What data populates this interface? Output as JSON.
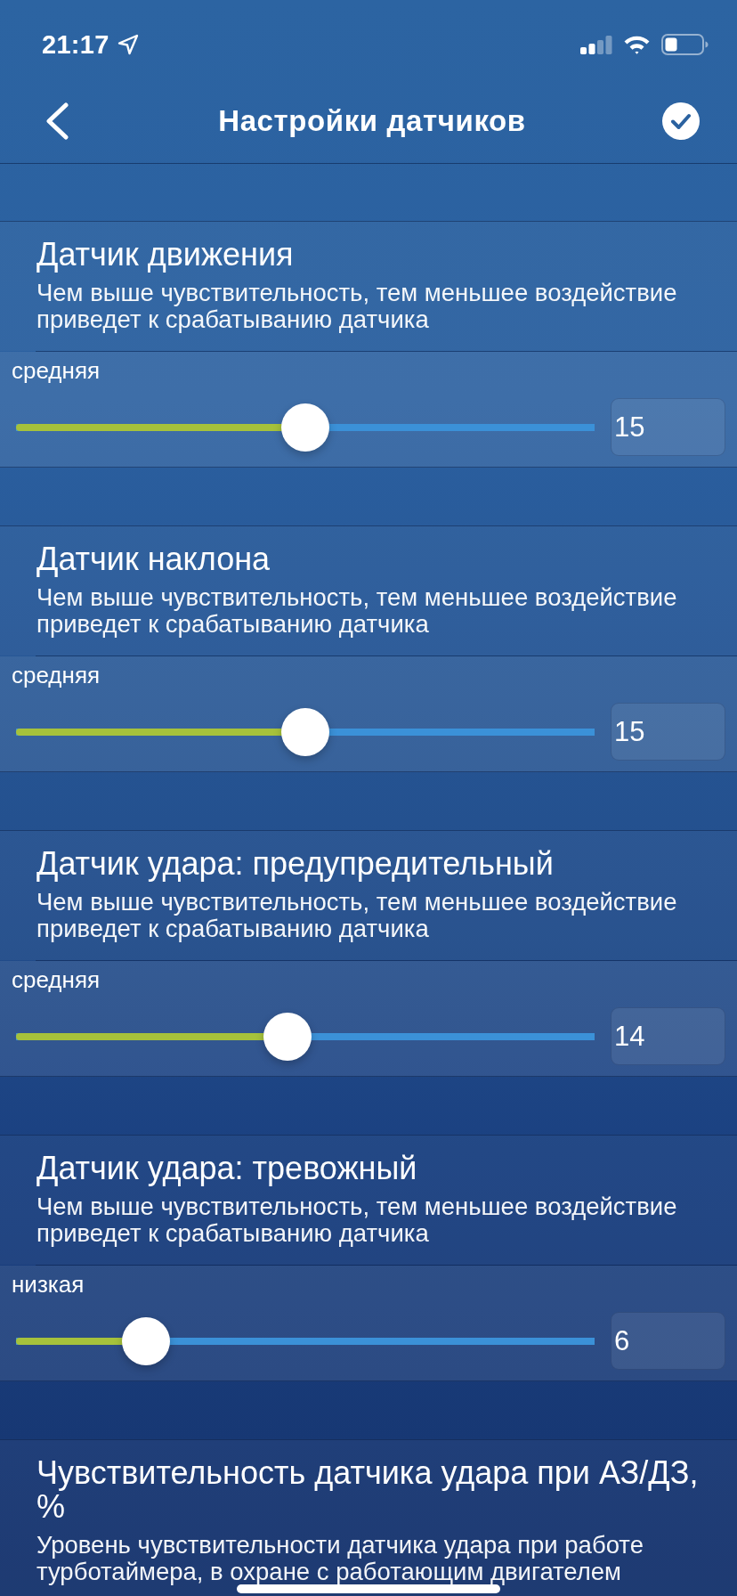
{
  "status_bar": {
    "time": "21:17"
  },
  "nav_bar": {
    "title": "Настройки датчиков"
  },
  "sections": [
    {
      "kind": "slider",
      "title": "Датчик движения",
      "description": "Чем выше чувствительность, тем меньшее воздействие приведет к срабатыванию датчика",
      "sensitivity_label": "средняя",
      "level": 0.5,
      "value": "15"
    },
    {
      "kind": "slider",
      "title": "Датчик наклона",
      "description": "Чем выше чувствительность, тем меньшее воздействие приведет к срабатыванию датчика",
      "sensitivity_label": "средняя",
      "level": 0.5,
      "value": "15"
    },
    {
      "kind": "slider",
      "title": "Датчик удара: предупредительный",
      "description": "Чем выше чувствительность, тем меньшее воздействие приведет к срабатыванию датчика",
      "sensitivity_label": "средняя",
      "level": 0.467,
      "value": "14"
    },
    {
      "kind": "slider",
      "title": "Датчик удара: тревожный",
      "description": "Чем выше чувствительность, тем меньшее воздействие приведет к срабатыванию датчика",
      "sensitivity_label": "низкая",
      "level": 0.2,
      "value": "6"
    },
    {
      "kind": "text",
      "title": "Чувствительность датчика удара при АЗ/ДЗ, %",
      "description": "Уровень чувствительности датчика удара при работе турботаймера, в охране с работающим двигателем"
    }
  ]
}
